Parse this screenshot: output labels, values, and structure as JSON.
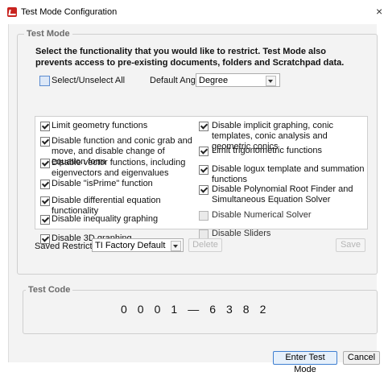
{
  "window": {
    "title": "Test Mode Configuration",
    "close_glyph": "×"
  },
  "test_mode": {
    "legend": "Test Mode",
    "instructions": "Select the functionality that you would like to restrict. Test Mode also prevents access to pre-existing documents, folders and Scratchpad data.",
    "select_all_label": "Select/Unselect All",
    "default_angle_label": "Default Angle:",
    "default_angle_value": "Degree",
    "left_options": [
      {
        "label": "Limit geometry functions",
        "checked": true
      },
      {
        "label": "Disable function and conic grab and move, and disable change of equation form",
        "checked": true
      },
      {
        "label": "Disable vector functions, including eigenvectors and eigenvalues",
        "checked": true
      },
      {
        "label": "Disable \"isPrime\" function",
        "checked": true
      },
      {
        "label": "Disable differential equation functionality",
        "checked": true
      },
      {
        "label": "Disable inequality graphing",
        "checked": true
      },
      {
        "label": "Disable 3D graphing",
        "checked": true
      }
    ],
    "right_options": [
      {
        "label": "Disable implicit graphing, conic templates, conic analysis and geometric conics",
        "checked": true
      },
      {
        "label": "Limit trigonometric functions",
        "checked": true
      },
      {
        "label": "Disable logux template and summation functions",
        "checked": true
      },
      {
        "label": "Disable Polynomial Root Finder and Simultaneous Equation Solver",
        "checked": true
      },
      {
        "label": "Disable Numerical Solver",
        "checked": false
      },
      {
        "label": "Disable Sliders",
        "checked": false
      }
    ],
    "saved_restrictions_label": "Saved Restrictions",
    "saved_restrictions_value": "TI Factory Default",
    "delete_label": "Delete",
    "save_label": "Save"
  },
  "test_code": {
    "legend": "Test Code",
    "digits": [
      "0",
      "0",
      "0",
      "1",
      "—",
      "6",
      "3",
      "8",
      "2"
    ]
  },
  "footer": {
    "enter_label": "Enter Test Mode",
    "cancel_label": "Cancel"
  }
}
